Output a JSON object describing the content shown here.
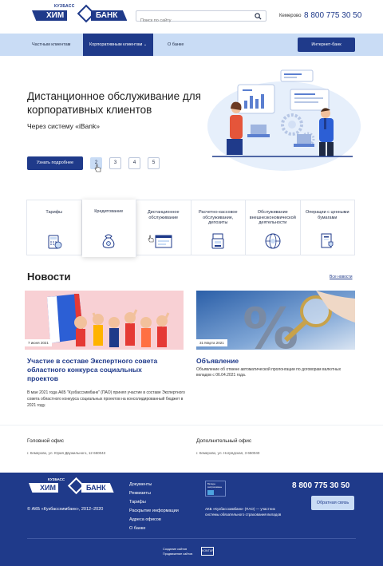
{
  "header": {
    "logo": {
      "top": "КУЗБАСС",
      "left": "ХИМ",
      "right": "БАНК"
    },
    "search_placeholder": "Поиск по сайту",
    "city": "Кемерово",
    "phone": "8 800 775 30 50"
  },
  "nav": {
    "items": [
      {
        "label": "Частным клиентам"
      },
      {
        "label": "Корпоративным клиентам"
      },
      {
        "label": "О банке"
      }
    ],
    "ibank": "Интернет-банк"
  },
  "hero": {
    "title": "Дистанционное обслуживание для корпоративных клиентов",
    "subtitle": "Через систему «iBank»",
    "button": "Узнать подробнее",
    "pages": [
      "2",
      "3",
      "4",
      "5"
    ],
    "active_page": "2"
  },
  "services": [
    {
      "label": "Тарифы",
      "icon": "calculator-icon"
    },
    {
      "label": "Кредитование",
      "icon": "money-bag-icon"
    },
    {
      "label": "Дистанционное обслуживание",
      "icon": "browser-window-icon"
    },
    {
      "label": "Расчетно-кассовое обслуживание, депозиты",
      "icon": "cash-register-icon"
    },
    {
      "label": "Обслуживание внешнеэкономической деятельности",
      "icon": "globe-icon"
    },
    {
      "label": "Операции с ценными бумагами",
      "icon": "securities-document-icon"
    }
  ],
  "news": {
    "heading": "Новости",
    "all_link": "Все новости",
    "items": [
      {
        "date": "7 июня 2021",
        "title": "Участие в составе Экспертного совета областного конкурса социальных проектов",
        "text": "В мае 2021 года АКБ \"Кузбассхимбанк\" (ПАО) принял участие в составе Экспертного совета областного конкурса социальных проектов на консолидированный бюджет в 2021 году."
      },
      {
        "date": "31 Марта 2021",
        "title": "Объявление",
        "text": "Объявление об отмене автоматической пролонгации по договорам валютных вкладов с 06.04.2021 года."
      }
    ]
  },
  "offices": [
    {
      "title": "Головной офис",
      "address": "г. Кемерово, ул. Юрия Двужильного, 12 650043"
    },
    {
      "title": "Дополнительный офис",
      "address": "г. Кемерово, ул. Ногрядская, 3 650040"
    }
  ],
  "footer": {
    "copyright": "© АКБ «Кузбассхимбанк», 2012–2020",
    "links": [
      "Документы",
      "Реквизиты",
      "Тарифы",
      "Раскрытие информации",
      "Адреса офисов",
      "О банке"
    ],
    "deposit_badge": "Вклады застрахованы",
    "deposit_text": "АКБ «Кузбассхимбанк» (ПАО) — участник системы обязательного страхования вкладов",
    "phone": "8 800 775 30 50",
    "feedback_button": "Обратная связь",
    "made_by": "Создание сайтов Продвижение сайтов",
    "studio": "KONTUR"
  },
  "colors": {
    "primary": "#1f3a8a",
    "nav_bg": "#c9dcf5",
    "footer_bg": "#1f3a8a"
  }
}
